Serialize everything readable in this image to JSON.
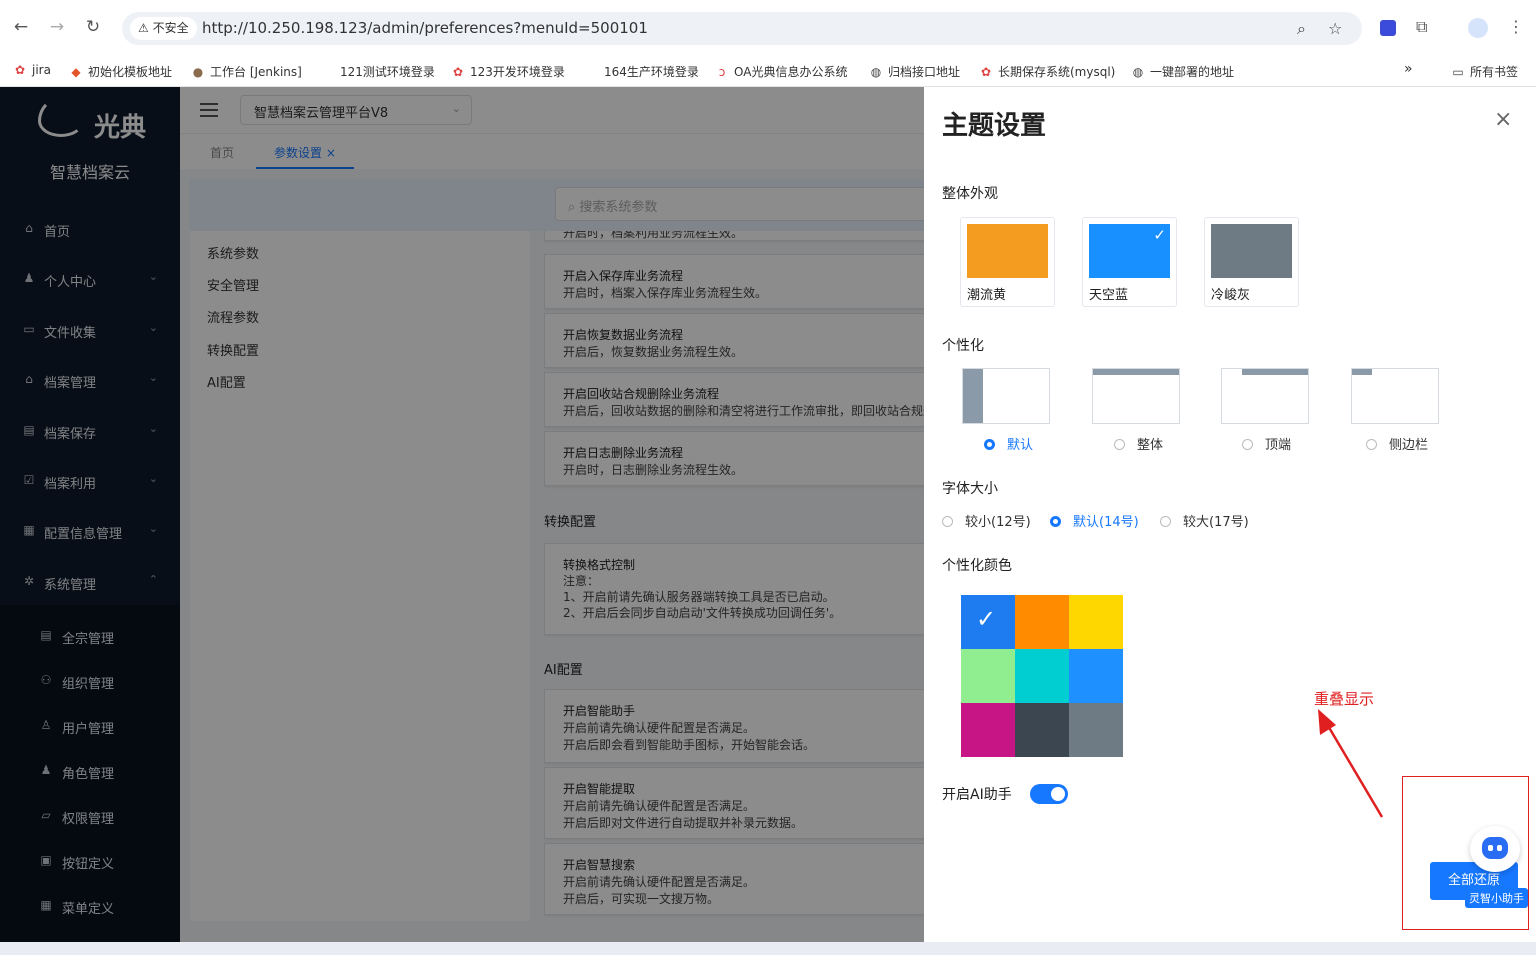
{
  "browser": {
    "url": "http://10.250.198.123/admin/preferences?menuId=500101",
    "insecure_label": "不安全",
    "all_bookmarks": "所有书签",
    "bookmarks": [
      "jira",
      "初始化模板地址",
      "工作台 [Jenkins]",
      "121测试环境登录",
      "123开发环境登录",
      "164生产环境登录",
      "OA光典信息办公系统",
      "归档接口地址",
      "长期保存系统(mysql)",
      "一键部署的地址"
    ]
  },
  "sidebar": {
    "logo_text": "光典",
    "subtitle": "智慧档案云",
    "items": [
      {
        "label": "首页",
        "icon": "home-icon"
      },
      {
        "label": "个人中心",
        "icon": "user-icon"
      },
      {
        "label": "文件收集",
        "icon": "briefcase-icon"
      },
      {
        "label": "档案管理",
        "icon": "bank-icon"
      },
      {
        "label": "档案保存",
        "icon": "archive-icon"
      },
      {
        "label": "档案利用",
        "icon": "checklist-icon"
      },
      {
        "label": "配置信息管理",
        "icon": "clipboard-icon"
      },
      {
        "label": "系统管理",
        "icon": "gear-icon"
      }
    ],
    "subitems": [
      {
        "label": "全宗管理",
        "icon": "list-icon"
      },
      {
        "label": "组织管理",
        "icon": "org-icon"
      },
      {
        "label": "用户管理",
        "icon": "person-icon"
      },
      {
        "label": "角色管理",
        "icon": "role-icon"
      },
      {
        "label": "权限管理",
        "icon": "folder-icon"
      },
      {
        "label": "按钮定义",
        "icon": "button-icon"
      },
      {
        "label": "菜单定义",
        "icon": "grid-icon"
      }
    ]
  },
  "header": {
    "system_select": "智慧档案云管理平台V8",
    "tabs": [
      {
        "label": "首页"
      },
      {
        "label": "参数设置",
        "close": "×"
      }
    ]
  },
  "params": {
    "search_placeholder": "搜索系统参数",
    "nav": [
      "系统参数",
      "安全管理",
      "流程参数",
      "转换配置",
      "AI配置"
    ],
    "cards_top": [
      {
        "title": "",
        "desc": "开启时，档案利用业务流程生效。"
      },
      {
        "title": "开启入保存库业务流程",
        "desc": "开启时，档案入保存库业务流程生效。"
      },
      {
        "title": "开启恢复数据业务流程",
        "desc": "开启后，恢复数据业务流程生效。"
      },
      {
        "title": "开启回收站合规删除业务流程",
        "desc": "开启后，回收站数据的删除和清空将进行工作流审批，即回收站合规删"
      },
      {
        "title": "开启日志删除业务流程",
        "desc": "开启时，日志删除业务流程生效。"
      }
    ],
    "section_convert": "转换配置",
    "convert_card": {
      "title": "转换格式控制",
      "lines": [
        "注意：",
        "1、开启前请先确认服务器端转换工具是否已启动。",
        "2、开启后会同步自动启动'文件转换成功回调任务'。"
      ]
    },
    "section_ai": "AI配置",
    "ai_cards": [
      {
        "title": "开启智能助手",
        "lines": [
          "开启前请先确认硬件配置是否满足。",
          "开启后即会看到智能助手图标，开始智能会话。"
        ]
      },
      {
        "title": "开启智能提取",
        "lines": [
          "开启前请先确认硬件配置是否满足。",
          "开启后即对文件进行自动提取并补录元数据。"
        ]
      },
      {
        "title": "开启智慧搜索",
        "lines": [
          "开启前请先确认硬件配置是否满足。",
          "开启后，可实现一文搜万物。"
        ]
      }
    ]
  },
  "drawer": {
    "title": "主题设置",
    "close": "×",
    "appearance_label": "整体外观",
    "themes": [
      {
        "name": "潮流黄",
        "color": "#f39c1f",
        "selected": false
      },
      {
        "name": "天空蓝",
        "color": "#1890ff",
        "selected": true
      },
      {
        "name": "冷峻灰",
        "color": "#6e7a84",
        "selected": false
      }
    ],
    "layout_label": "个性化",
    "layouts": [
      {
        "name": "默认",
        "selected": true
      },
      {
        "name": "整体",
        "selected": false
      },
      {
        "name": "顶端",
        "selected": false
      },
      {
        "name": "侧边栏",
        "selected": false
      }
    ],
    "font_label": "字体大小",
    "fonts": [
      {
        "name": "较小(12号)",
        "selected": false
      },
      {
        "name": "默认(14号)",
        "selected": true
      },
      {
        "name": "较大(17号)",
        "selected": false
      }
    ],
    "color_label": "个性化颜色",
    "colors": [
      "#1e7cf0",
      "#ff8c00",
      "#ffd700",
      "#90ee90",
      "#00ced1",
      "#1e90ff",
      "#c71585",
      "#3b4650",
      "#6e7a84"
    ],
    "ai_label": "开启AI助手",
    "ai_enabled": true,
    "reset_button": "全部还原",
    "assistant_label": "灵智小助手"
  },
  "annotation": {
    "text": "重叠显示",
    "color": "#e02020"
  }
}
